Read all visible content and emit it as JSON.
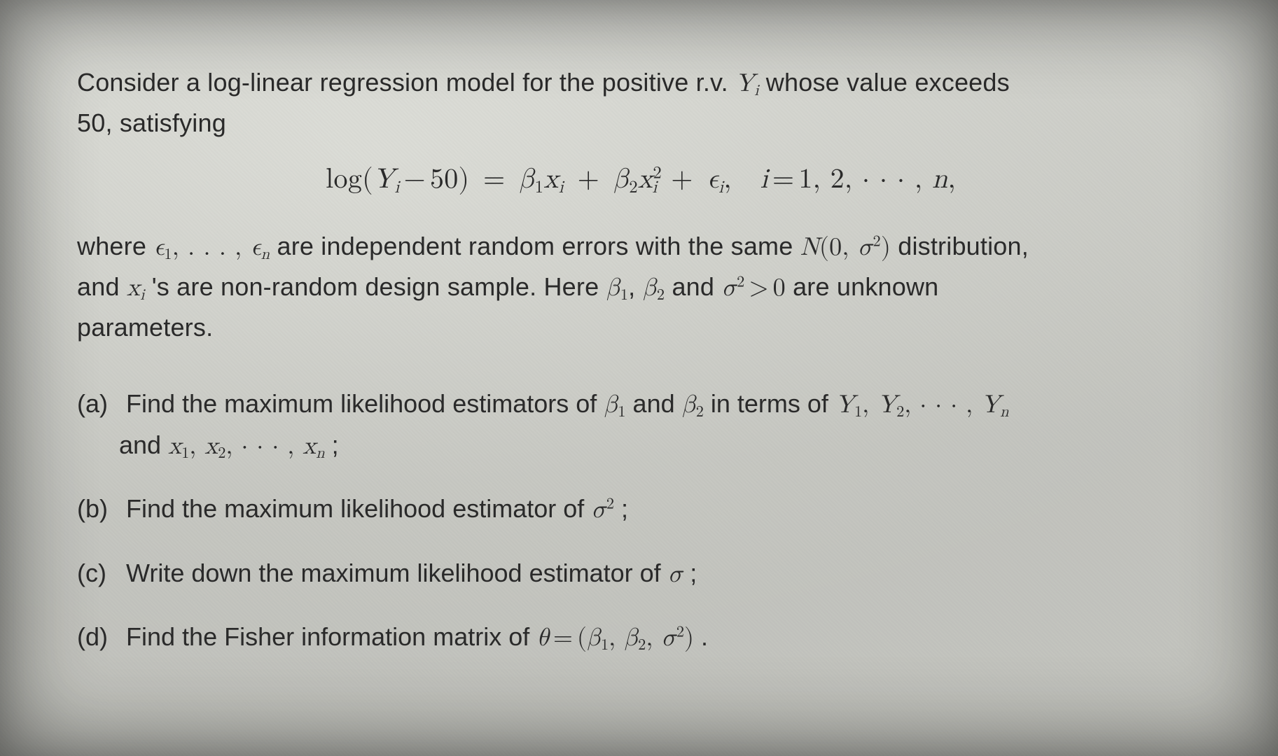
{
  "intro": {
    "line1_a": "Consider a log-linear regression model for the positive r.v. ",
    "line1_b": " whose value exceeds",
    "line2": "50, satisfying"
  },
  "equation": {
    "lhs_log": "log",
    "idx_range": "i = 1, 2, · · · , n,"
  },
  "where": {
    "a": "where ",
    "b": " are independent random errors with the same ",
    "c": " distribution,",
    "d": "and ",
    "e": "'s are non-random design sample.  Here ",
    "f": " and ",
    "g": " are unknown",
    "h": "parameters."
  },
  "parts": {
    "a": {
      "label": "(a)",
      "t1": "Find the maximum likelihood estimators of ",
      "t2": " and ",
      "t3": " in terms of ",
      "t4": "and ",
      "t5": ";"
    },
    "b": {
      "label": "(b)",
      "t1": "Find the maximum likelihood estimator of ",
      "t2": ";"
    },
    "c": {
      "label": "(c)",
      "t1": "Write down the maximum likelihood estimator of ",
      "t2": ";"
    },
    "d": {
      "label": "(d)",
      "t1": "Find the Fisher information matrix of ",
      "t2": "."
    }
  }
}
